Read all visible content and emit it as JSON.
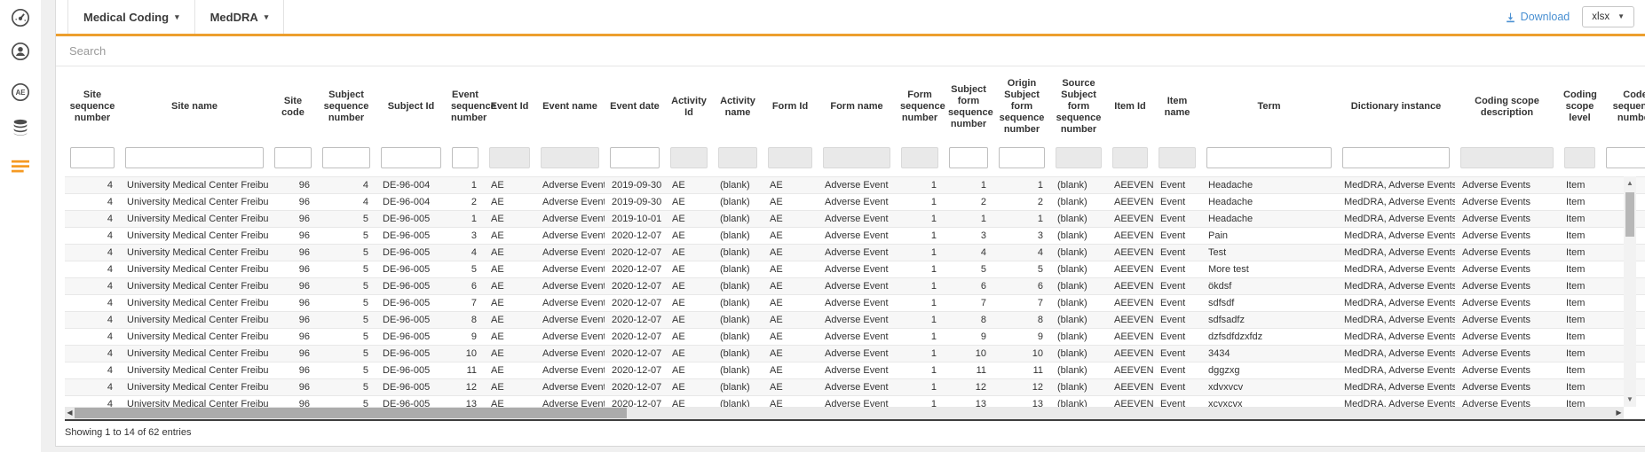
{
  "sidebar": {
    "items": [
      {
        "id": "dashboard",
        "icon": "gauge-icon",
        "active": false
      },
      {
        "id": "profile",
        "icon": "user-icon",
        "active": false
      },
      {
        "id": "adverse-events",
        "icon": "ae-badge-icon",
        "badge": "AE",
        "active": false
      },
      {
        "id": "data",
        "icon": "database-icon",
        "active": false
      },
      {
        "id": "listings",
        "icon": "list-icon",
        "active": true
      }
    ]
  },
  "topbar": {
    "tabs": [
      {
        "label": "Medical Coding"
      },
      {
        "label": "MedDRA"
      }
    ],
    "download_label": "Download",
    "format_selected": "xlsx"
  },
  "search": {
    "placeholder": "Search"
  },
  "table": {
    "columns": [
      {
        "id": "site_seq",
        "label": "Site sequence number",
        "filter_enabled": true
      },
      {
        "id": "site_name",
        "label": "Site name",
        "filter_enabled": true
      },
      {
        "id": "site_code",
        "label": "Site code",
        "filter_enabled": true
      },
      {
        "id": "subject_seq",
        "label": "Subject sequence number",
        "filter_enabled": true
      },
      {
        "id": "subject_id",
        "label": "Subject Id",
        "filter_enabled": true
      },
      {
        "id": "event_seq",
        "label": "Event sequence number",
        "filter_enabled": true
      },
      {
        "id": "event_id",
        "label": "Event Id",
        "filter_enabled": false
      },
      {
        "id": "event_name",
        "label": "Event name",
        "filter_enabled": false
      },
      {
        "id": "event_date",
        "label": "Event date",
        "filter_enabled": true
      },
      {
        "id": "activity_id",
        "label": "Activity Id",
        "filter_enabled": false
      },
      {
        "id": "activity_name",
        "label": "Activity name",
        "filter_enabled": false
      },
      {
        "id": "form_id",
        "label": "Form Id",
        "filter_enabled": false
      },
      {
        "id": "form_name",
        "label": "Form name",
        "filter_enabled": false
      },
      {
        "id": "form_seq",
        "label": "Form sequence number",
        "filter_enabled": false
      },
      {
        "id": "subject_form_seq",
        "label": "Subject form sequence number",
        "filter_enabled": true
      },
      {
        "id": "origin_subject_form_seq",
        "label": "Origin Subject form sequence number",
        "filter_enabled": true
      },
      {
        "id": "source_subject_form_seq",
        "label": "Source Subject form sequence number",
        "filter_enabled": false
      },
      {
        "id": "item_id",
        "label": "Item Id",
        "filter_enabled": false
      },
      {
        "id": "item_name",
        "label": "Item name",
        "filter_enabled": false
      },
      {
        "id": "term",
        "label": "Term",
        "filter_enabled": true
      },
      {
        "id": "dictionary_instance",
        "label": "Dictionary instance",
        "filter_enabled": true
      },
      {
        "id": "coding_scope_description",
        "label": "Coding scope description",
        "filter_enabled": false
      },
      {
        "id": "coding_scope_level",
        "label": "Coding scope level",
        "filter_enabled": false
      },
      {
        "id": "code_seq",
        "label": "Code sequence number",
        "filter_enabled": true
      }
    ],
    "rows": [
      [
        4,
        "University Medical Center Freiburg",
        96,
        4,
        "DE-96-004",
        1,
        "AE",
        "Adverse Events",
        "2019-09-30",
        "AE",
        "(blank)",
        "AE",
        "Adverse Event",
        1,
        1,
        1,
        "(blank)",
        "AEEVENT",
        "Event",
        "Headache",
        "MedDRA, Adverse Events",
        "Adverse Events",
        "Item",
        ""
      ],
      [
        4,
        "University Medical Center Freiburg",
        96,
        4,
        "DE-96-004",
        2,
        "AE",
        "Adverse Events",
        "2019-09-30",
        "AE",
        "(blank)",
        "AE",
        "Adverse Event",
        1,
        2,
        2,
        "(blank)",
        "AEEVENT",
        "Event",
        "Headache",
        "MedDRA, Adverse Events",
        "Adverse Events",
        "Item",
        ""
      ],
      [
        4,
        "University Medical Center Freiburg",
        96,
        5,
        "DE-96-005",
        1,
        "AE",
        "Adverse Events",
        "2019-10-01",
        "AE",
        "(blank)",
        "AE",
        "Adverse Event",
        1,
        1,
        1,
        "(blank)",
        "AEEVENT",
        "Event",
        "Headache",
        "MedDRA, Adverse Events",
        "Adverse Events",
        "Item",
        ""
      ],
      [
        4,
        "University Medical Center Freiburg",
        96,
        5,
        "DE-96-005",
        3,
        "AE",
        "Adverse Events",
        "2020-12-07",
        "AE",
        "(blank)",
        "AE",
        "Adverse Event",
        1,
        3,
        3,
        "(blank)",
        "AEEVENT",
        "Event",
        "Pain",
        "MedDRA, Adverse Events",
        "Adverse Events",
        "Item",
        ""
      ],
      [
        4,
        "University Medical Center Freiburg",
        96,
        5,
        "DE-96-005",
        4,
        "AE",
        "Adverse Events",
        "2020-12-07",
        "AE",
        "(blank)",
        "AE",
        "Adverse Event",
        1,
        4,
        4,
        "(blank)",
        "AEEVENT",
        "Event",
        "Test",
        "MedDRA, Adverse Events",
        "Adverse Events",
        "Item",
        ""
      ],
      [
        4,
        "University Medical Center Freiburg",
        96,
        5,
        "DE-96-005",
        5,
        "AE",
        "Adverse Events",
        "2020-12-07",
        "AE",
        "(blank)",
        "AE",
        "Adverse Event",
        1,
        5,
        5,
        "(blank)",
        "AEEVENT",
        "Event",
        "More test",
        "MedDRA, Adverse Events",
        "Adverse Events",
        "Item",
        ""
      ],
      [
        4,
        "University Medical Center Freiburg",
        96,
        5,
        "DE-96-005",
        6,
        "AE",
        "Adverse Events",
        "2020-12-07",
        "AE",
        "(blank)",
        "AE",
        "Adverse Event",
        1,
        6,
        6,
        "(blank)",
        "AEEVENT",
        "Event",
        "ökdsf",
        "MedDRA, Adverse Events",
        "Adverse Events",
        "Item",
        ""
      ],
      [
        4,
        "University Medical Center Freiburg",
        96,
        5,
        "DE-96-005",
        7,
        "AE",
        "Adverse Events",
        "2020-12-07",
        "AE",
        "(blank)",
        "AE",
        "Adverse Event",
        1,
        7,
        7,
        "(blank)",
        "AEEVENT",
        "Event",
        "sdfsdf",
        "MedDRA, Adverse Events",
        "Adverse Events",
        "Item",
        ""
      ],
      [
        4,
        "University Medical Center Freiburg",
        96,
        5,
        "DE-96-005",
        8,
        "AE",
        "Adverse Events",
        "2020-12-07",
        "AE",
        "(blank)",
        "AE",
        "Adverse Event",
        1,
        8,
        8,
        "(blank)",
        "AEEVENT",
        "Event",
        "sdfsadfz",
        "MedDRA, Adverse Events",
        "Adverse Events",
        "Item",
        ""
      ],
      [
        4,
        "University Medical Center Freiburg",
        96,
        5,
        "DE-96-005",
        9,
        "AE",
        "Adverse Events",
        "2020-12-07",
        "AE",
        "(blank)",
        "AE",
        "Adverse Event",
        1,
        9,
        9,
        "(blank)",
        "AEEVENT",
        "Event",
        "dzfsdfdzxfdz",
        "MedDRA, Adverse Events",
        "Adverse Events",
        "Item",
        ""
      ],
      [
        4,
        "University Medical Center Freiburg",
        96,
        5,
        "DE-96-005",
        10,
        "AE",
        "Adverse Events",
        "2020-12-07",
        "AE",
        "(blank)",
        "AE",
        "Adverse Event",
        1,
        10,
        10,
        "(blank)",
        "AEEVENT",
        "Event",
        "3434",
        "MedDRA, Adverse Events",
        "Adverse Events",
        "Item",
        ""
      ],
      [
        4,
        "University Medical Center Freiburg",
        96,
        5,
        "DE-96-005",
        11,
        "AE",
        "Adverse Events",
        "2020-12-07",
        "AE",
        "(blank)",
        "AE",
        "Adverse Event",
        1,
        11,
        11,
        "(blank)",
        "AEEVENT",
        "Event",
        "dggzxg",
        "MedDRA, Adverse Events",
        "Adverse Events",
        "Item",
        ""
      ],
      [
        4,
        "University Medical Center Freiburg",
        96,
        5,
        "DE-96-005",
        12,
        "AE",
        "Adverse Events",
        "2020-12-07",
        "AE",
        "(blank)",
        "AE",
        "Adverse Event",
        1,
        12,
        12,
        "(blank)",
        "AEEVENT",
        "Event",
        "xdvxvcv",
        "MedDRA, Adverse Events",
        "Adverse Events",
        "Item",
        ""
      ],
      [
        4,
        "University Medical Center Freiburg",
        96,
        5,
        "DE-96-005",
        13,
        "AE",
        "Adverse Events",
        "2020-12-07",
        "AE",
        "(blank)",
        "AE",
        "Adverse Event",
        1,
        13,
        13,
        "(blank)",
        "AEEVENT",
        "Event",
        "xcvxcvx",
        "MedDRA, Adverse Events",
        "Adverse Events",
        "Item",
        ""
      ]
    ]
  },
  "footer": {
    "summary": "Showing 1 to 14 of 62 entries"
  },
  "colors": {
    "accent_orange": "#ec9f2e",
    "link_blue": "#4a90d2",
    "icon_gray": "#4c4c4c",
    "row_stripe": "#f7f7f7"
  }
}
